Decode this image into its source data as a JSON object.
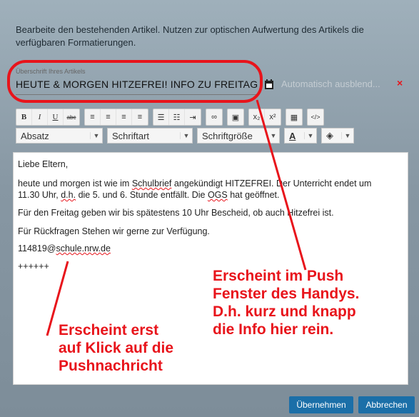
{
  "dialog": {
    "intro": "Bearbeite den bestehenden Artikel. Nutzen zur optischen Aufwertung des Artikels die verfügbaren Formatierungen.",
    "title_label": "Überschrift Ihres Artikels",
    "title_value": "HEUTE & MORGEN HITZEFREI! INFO ZU FREITAG FO",
    "autohide_placeholder": "Automatisch ausblend...",
    "autohide_clear": "×",
    "toolbar": {
      "bold": "B",
      "italic": "I",
      "underline": "U",
      "strike": "abc",
      "subscript": "x₂",
      "superscript": "x²",
      "source": "</>",
      "format_select": "Absatz",
      "font_select": "Schriftart",
      "size_select": "Schriftgröße",
      "font_color": "A"
    },
    "body": {
      "greeting": "Liebe Eltern,",
      "line1_a": "heute und morgen ist wie im ",
      "line1_b": "Schulbrief",
      "line1_c": " angekündigt HITZEFREI. Der Unterricht endet um",
      "line2_a": "11.30 Uhr, ",
      "line2_b": "d.h.",
      "line2_c": " die 5. und 6. Stunde entfällt. Die ",
      "line2_d": "OGS",
      "line2_e": " hat geöffnet.",
      "line3": "Für den Freitag geben wir bis spätestens 10 Uhr Bescheid, ob auch Hitzefrei ist.",
      "line4": "Für Rückfragen Stehen wir gerne zur Verfügung.",
      "email_a": "114819@",
      "email_b": "schule.nrw.de",
      "sep": "++++++"
    },
    "buttons": {
      "ok": "Übernehmen",
      "cancel": "Abbrechen"
    }
  },
  "annotations": {
    "push_line1": "Erscheint im Push",
    "push_line2": "Fenster des Handys.",
    "push_line3": "D.h. kurz und knapp",
    "push_line4": "die Info hier rein.",
    "click_line1": "Erscheint erst",
    "click_line2": "auf Klick auf die",
    "click_line3": "Pushnachricht"
  },
  "colors": {
    "annotation_red": "#e8141b",
    "primary_button": "#1b6fa8"
  }
}
